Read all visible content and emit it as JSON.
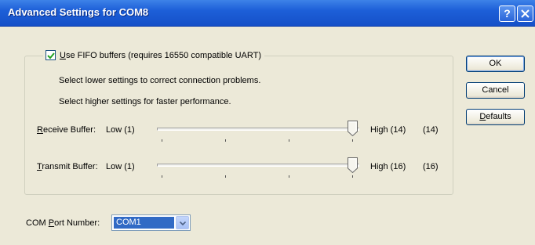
{
  "window": {
    "title": "Advanced Settings for COM8",
    "help_glyph": "?"
  },
  "fifo": {
    "checked": true,
    "label_accel": "U",
    "label_rest": "se FIFO buffers (requires 16550 compatible UART)"
  },
  "hints": {
    "line1": "Select lower settings to correct connection problems.",
    "line2": "Select higher settings for faster performance."
  },
  "receive": {
    "label_accel": "R",
    "label_rest": "eceive Buffer:",
    "low": "Low (1)",
    "high": "High (14)",
    "value": "(14)"
  },
  "transmit": {
    "label_accel": "T",
    "label_rest": "ransmit Buffer:",
    "low": "Low (1)",
    "high": "High (16)",
    "value": "(16)"
  },
  "buttons": {
    "ok": "OK",
    "cancel": "Cancel",
    "defaults_accel": "D",
    "defaults_rest": "efaults"
  },
  "com_port": {
    "label_pre": "COM ",
    "label_accel": "P",
    "label_rest": "ort Number:",
    "selected": "COM1"
  }
}
